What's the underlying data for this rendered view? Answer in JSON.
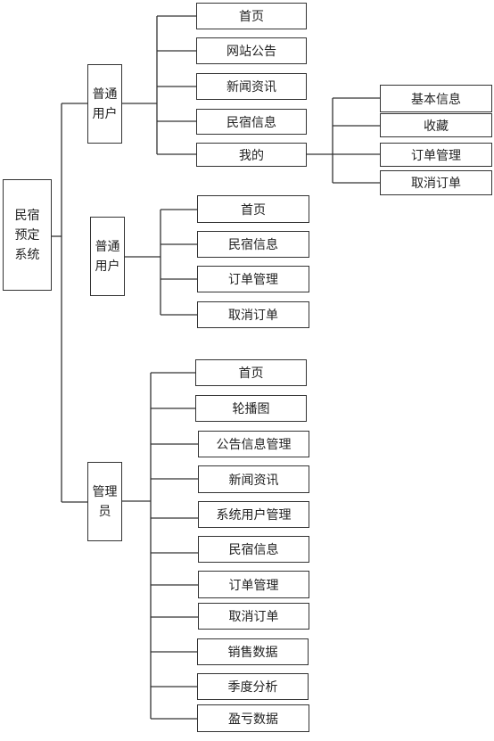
{
  "root": {
    "label": "民宿预定系统",
    "lines": [
      "民宿",
      "预定",
      "系统"
    ]
  },
  "groups": [
    {
      "lines": [
        "普通",
        "用户"
      ],
      "items": [
        "首页",
        "网站公告",
        "新闻资讯",
        "民宿信息",
        "我的"
      ],
      "submenu": {
        "parent": "我的",
        "items": [
          "基本信息",
          "收藏",
          "订单管理",
          "取消订单"
        ]
      }
    },
    {
      "lines": [
        "普通",
        "用户"
      ],
      "items": [
        "首页",
        "民宿信息",
        "订单管理",
        "取消订单"
      ]
    },
    {
      "lines": [
        "管理",
        "员"
      ],
      "items": [
        "首页",
        "轮播图",
        "公告信息管理",
        "新闻资讯",
        "系统用户管理",
        "民宿信息",
        "订单管理",
        "取消订单",
        "销售数据",
        "季度分析",
        "盈亏数据"
      ]
    }
  ],
  "colors": {
    "line": "#333333",
    "box_border": "#333333"
  }
}
